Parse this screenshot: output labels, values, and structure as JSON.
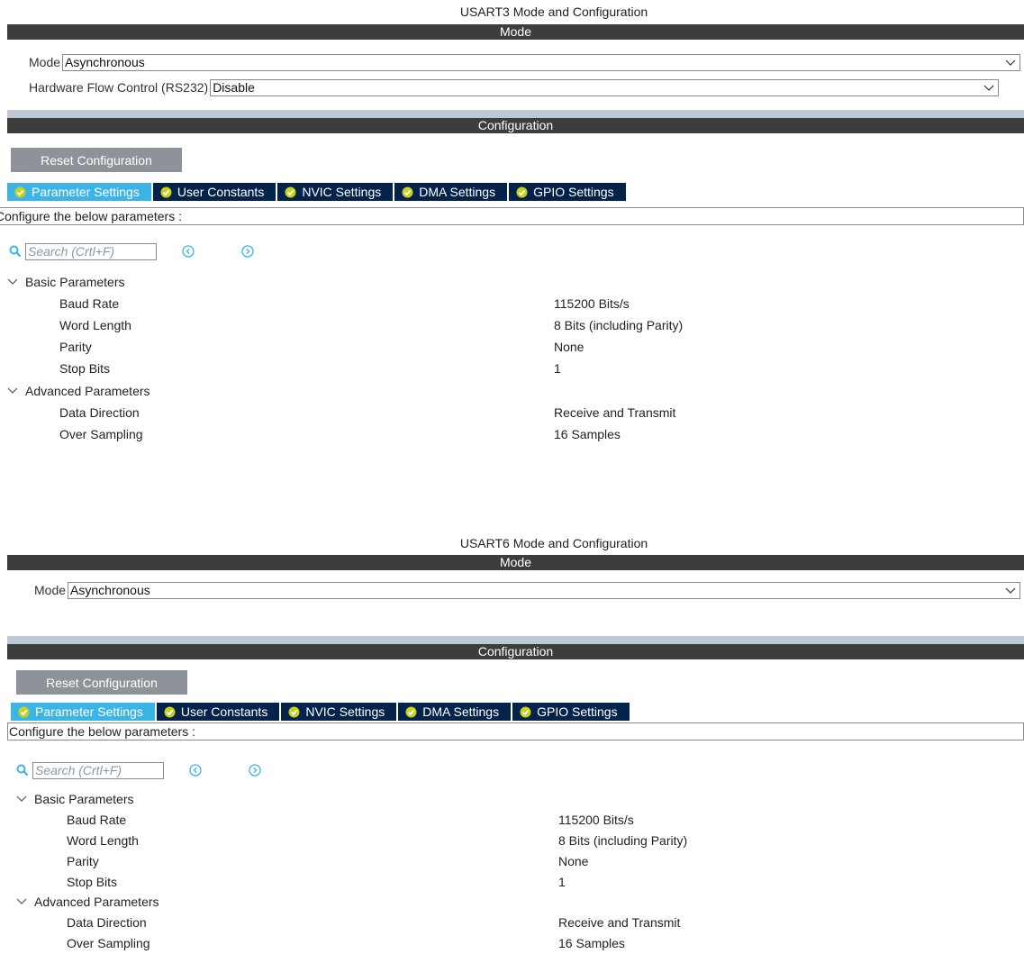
{
  "usart3": {
    "title": "USART3 Mode and Configuration",
    "mode_header": "Mode",
    "mode_label": "Mode",
    "mode_value": "Asynchronous",
    "hfc_label": "Hardware Flow Control (RS232)",
    "hfc_value": "Disable",
    "config_header": "Configuration",
    "reset_label": "Reset Configuration",
    "tabs": [
      "Parameter Settings",
      "User Constants",
      "NVIC Settings",
      "DMA Settings",
      "GPIO Settings"
    ],
    "config_text": "Configure the below parameters :",
    "search_placeholder": "Search (Crtl+F)",
    "basic_group": "Basic Parameters",
    "basic": [
      {
        "name": "Baud Rate",
        "value": "115200 Bits/s"
      },
      {
        "name": "Word Length",
        "value": "8 Bits (including Parity)"
      },
      {
        "name": "Parity",
        "value": "None"
      },
      {
        "name": "Stop Bits",
        "value": "1"
      }
    ],
    "advanced_group": "Advanced Parameters",
    "advanced": [
      {
        "name": "Data Direction",
        "value": "Receive and Transmit"
      },
      {
        "name": "Over Sampling",
        "value": "16 Samples"
      }
    ]
  },
  "usart6": {
    "title": "USART6 Mode and Configuration",
    "mode_header": "Mode",
    "mode_label": "Mode",
    "mode_value": "Asynchronous",
    "config_header": "Configuration",
    "reset_label": "Reset Configuration",
    "tabs": [
      "Parameter Settings",
      "User Constants",
      "NVIC Settings",
      "DMA Settings",
      "GPIO Settings"
    ],
    "config_text": "Configure the below parameters :",
    "search_placeholder": "Search (Crtl+F)",
    "basic_group": "Basic Parameters",
    "basic": [
      {
        "name": "Baud Rate",
        "value": "115200 Bits/s"
      },
      {
        "name": "Word Length",
        "value": "8 Bits (including Parity)"
      },
      {
        "name": "Parity",
        "value": "None"
      },
      {
        "name": "Stop Bits",
        "value": "1"
      }
    ],
    "advanced_group": "Advanced Parameters",
    "advanced": [
      {
        "name": "Data Direction",
        "value": "Receive and Transmit"
      },
      {
        "name": "Over Sampling",
        "value": "16 Samples"
      }
    ]
  },
  "colors": {
    "header_bar": "#3d3d3d",
    "divider_bar": "#bcc8d4",
    "tab_inactive": "#03234b",
    "tab_active": "#3cb4e6",
    "check_icon": "#c8d21e",
    "button_gray": "#8e9399",
    "search_icon": "#3cb4e6"
  }
}
